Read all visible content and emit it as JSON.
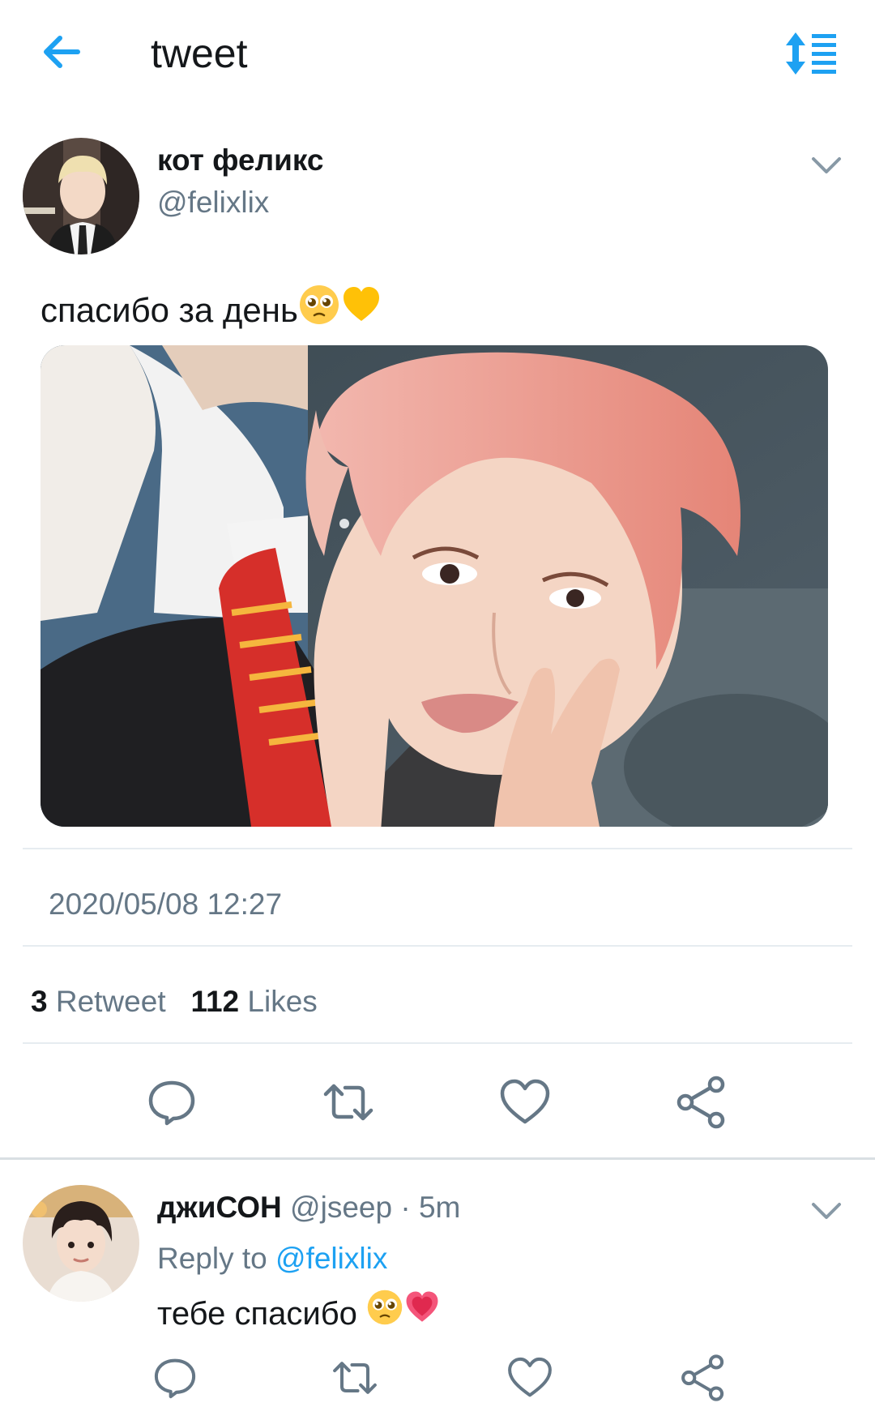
{
  "header": {
    "title": "tweet",
    "back_icon": "arrow-left-icon",
    "sort_icon": "sort-icon",
    "accent_color": "#1da1f2"
  },
  "tweet": {
    "author_name": "кот феликс",
    "author_handle": "@felixlix",
    "text": "спасибо за день",
    "emojis": [
      "pleading-face-emoji",
      "yellow-heart-emoji"
    ],
    "media_alt_icon": "photo",
    "timestamp": "2020/05/08 12:27",
    "stats": {
      "retweet_count": "3",
      "retweet_label": "Retweet",
      "likes_count": "112",
      "likes_label": "Likes"
    },
    "actions": [
      "reply-icon",
      "retweet-icon",
      "like-icon",
      "share-icon"
    ]
  },
  "reply": {
    "author_name": "джиСОН",
    "author_handle": "@jseep",
    "separator": " · ",
    "time": "5m",
    "reply_to_label": "Reply to",
    "reply_to_handle": "@felixlix",
    "text": "тебе спасибо",
    "emojis": [
      "pleading-face-emoji",
      "heart-emoji"
    ],
    "actions": [
      "reply-icon",
      "retweet-icon",
      "like-icon",
      "share-icon"
    ]
  }
}
